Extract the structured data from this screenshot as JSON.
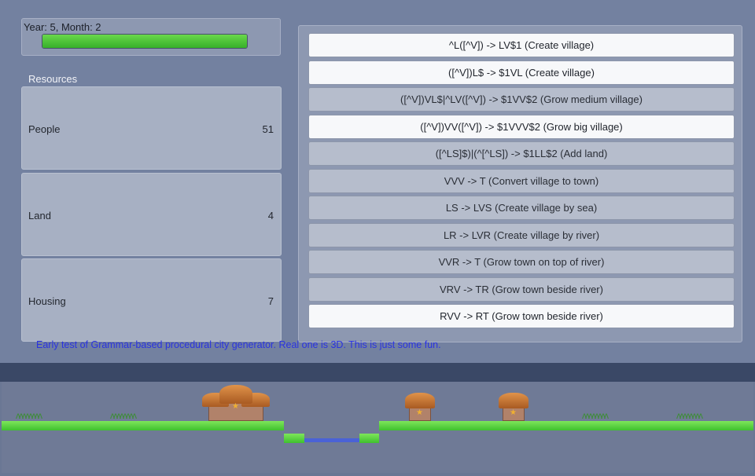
{
  "status": {
    "text": "Year: 5, Month: 2",
    "progress": 1.0
  },
  "resources": {
    "title": "Resources",
    "items": [
      {
        "label": "People",
        "value": "51"
      },
      {
        "label": "Land",
        "value": "4"
      },
      {
        "label": "Housing",
        "value": "7"
      }
    ]
  },
  "rules": [
    {
      "label": "^L([^V]) -> LV$1 (Create village)",
      "enabled": true
    },
    {
      "label": "([^V])L$ -> $1VL (Create village)",
      "enabled": true
    },
    {
      "label": "([^V])VL$|^LV([^V]) -> $1VV$2 (Grow medium village)",
      "enabled": false
    },
    {
      "label": "([^V])VV([^V]) -> $1VVV$2 (Grow big village)",
      "enabled": true
    },
    {
      "label": "([^LS]$)|(^[^LS]) -> $1LL$2 (Add land)",
      "enabled": false
    },
    {
      "label": "VVV -> T (Convert village to town)",
      "enabled": false
    },
    {
      "label": "LS -> LVS (Create village by sea)",
      "enabled": false
    },
    {
      "label": "LR -> LVR (Create village by river)",
      "enabled": false
    },
    {
      "label": "VVR -> T (Grow town on top of river)",
      "enabled": false
    },
    {
      "label": "VRV -> TR (Grow town beside river)",
      "enabled": false
    },
    {
      "label": "RVV -> RT (Grow town beside river)",
      "enabled": true
    }
  ],
  "caption": "Early test of Grammar-based procedural city generator. Real one is 3D. This is just some fun.",
  "colors": {
    "progress": "#4cc63a",
    "caption": "#2a33e0",
    "grass": "#5cd442",
    "water": "#4a62d6"
  }
}
